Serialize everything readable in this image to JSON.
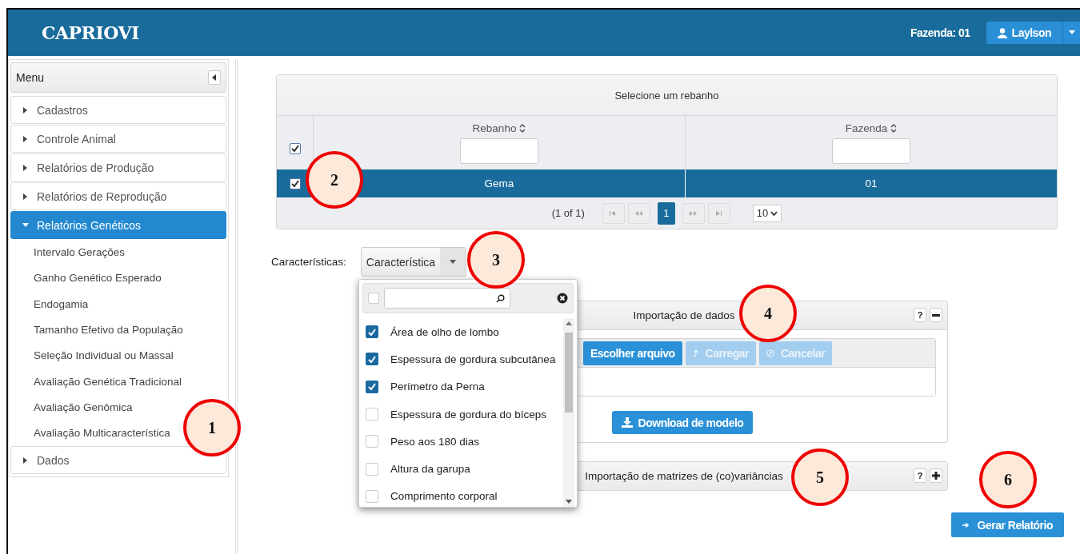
{
  "header": {
    "logo": "CAPRIOVI",
    "farm": "Fazenda: 01",
    "user": "Laylson"
  },
  "sidebar": {
    "title": "Menu",
    "items": [
      {
        "label": "Cadastros",
        "expanded": false,
        "selected": false
      },
      {
        "label": "Controle Animal",
        "expanded": false,
        "selected": false
      },
      {
        "label": "Relatórios de Produção",
        "expanded": false,
        "selected": false
      },
      {
        "label": "Relatórios de Reprodução",
        "expanded": false,
        "selected": false
      },
      {
        "label": "Relatórios Genéticos",
        "expanded": true,
        "selected": true,
        "children": [
          {
            "label": "Intervalo Gerações"
          },
          {
            "label": "Ganho Genético Esperado"
          },
          {
            "label": "Endogamia"
          },
          {
            "label": "Tamanho Efetivo da População"
          },
          {
            "label": "Seleção Individual ou Massal"
          },
          {
            "label": "Avaliação Genética Tradicional"
          },
          {
            "label": "Avaliação Genômica"
          },
          {
            "label": "Avaliação Multicaracterística"
          }
        ]
      },
      {
        "label": "Dados",
        "expanded": false,
        "selected": false
      }
    ]
  },
  "table": {
    "title": "Selecione um rebanho",
    "select_all_checked": true,
    "columns": [
      {
        "label": "Rebanho"
      },
      {
        "label": "Fazenda"
      }
    ],
    "rows": [
      {
        "cells": [
          "Gema",
          "01"
        ],
        "checked": true,
        "selected": true
      }
    ],
    "paginator": {
      "status": "(1 of 1)",
      "pages": [
        {
          "label": "1",
          "selected": true
        }
      ],
      "rows_per_page": "10"
    }
  },
  "characteristics": {
    "label": "Características:",
    "button": "Característica",
    "dropdown": {
      "select_all_checked": false,
      "items": [
        {
          "label": "Área de olho de lombo",
          "checked": true
        },
        {
          "label": "Espessura de gordura subcutânea",
          "checked": true
        },
        {
          "label": "Perímetro da Perna",
          "checked": true
        },
        {
          "label": "Espessura de gordura do bíceps",
          "checked": false
        },
        {
          "label": "Peso aos 180 dias",
          "checked": false
        },
        {
          "label": "Altura da garupa",
          "checked": false
        },
        {
          "label": "Comprimento corporal",
          "checked": false
        }
      ]
    }
  },
  "panels": [
    {
      "title": "Importação de dados",
      "help": "?",
      "expanded": true,
      "buttons": [
        {
          "label": "Escolher arquivo",
          "disabled": false
        },
        {
          "label": "Carregar",
          "disabled": true
        },
        {
          "label": "Cancelar",
          "disabled": true
        }
      ],
      "download": "Download de modelo"
    },
    {
      "title": "Importação de matrizes de (co)variâncias",
      "help": "?",
      "expanded": false
    }
  ],
  "generate_button": "Gerar Relatório",
  "callouts": [
    {
      "label": "1"
    },
    {
      "label": "2"
    },
    {
      "label": "3"
    },
    {
      "label": "4"
    },
    {
      "label": "5"
    },
    {
      "label": "6"
    }
  ]
}
